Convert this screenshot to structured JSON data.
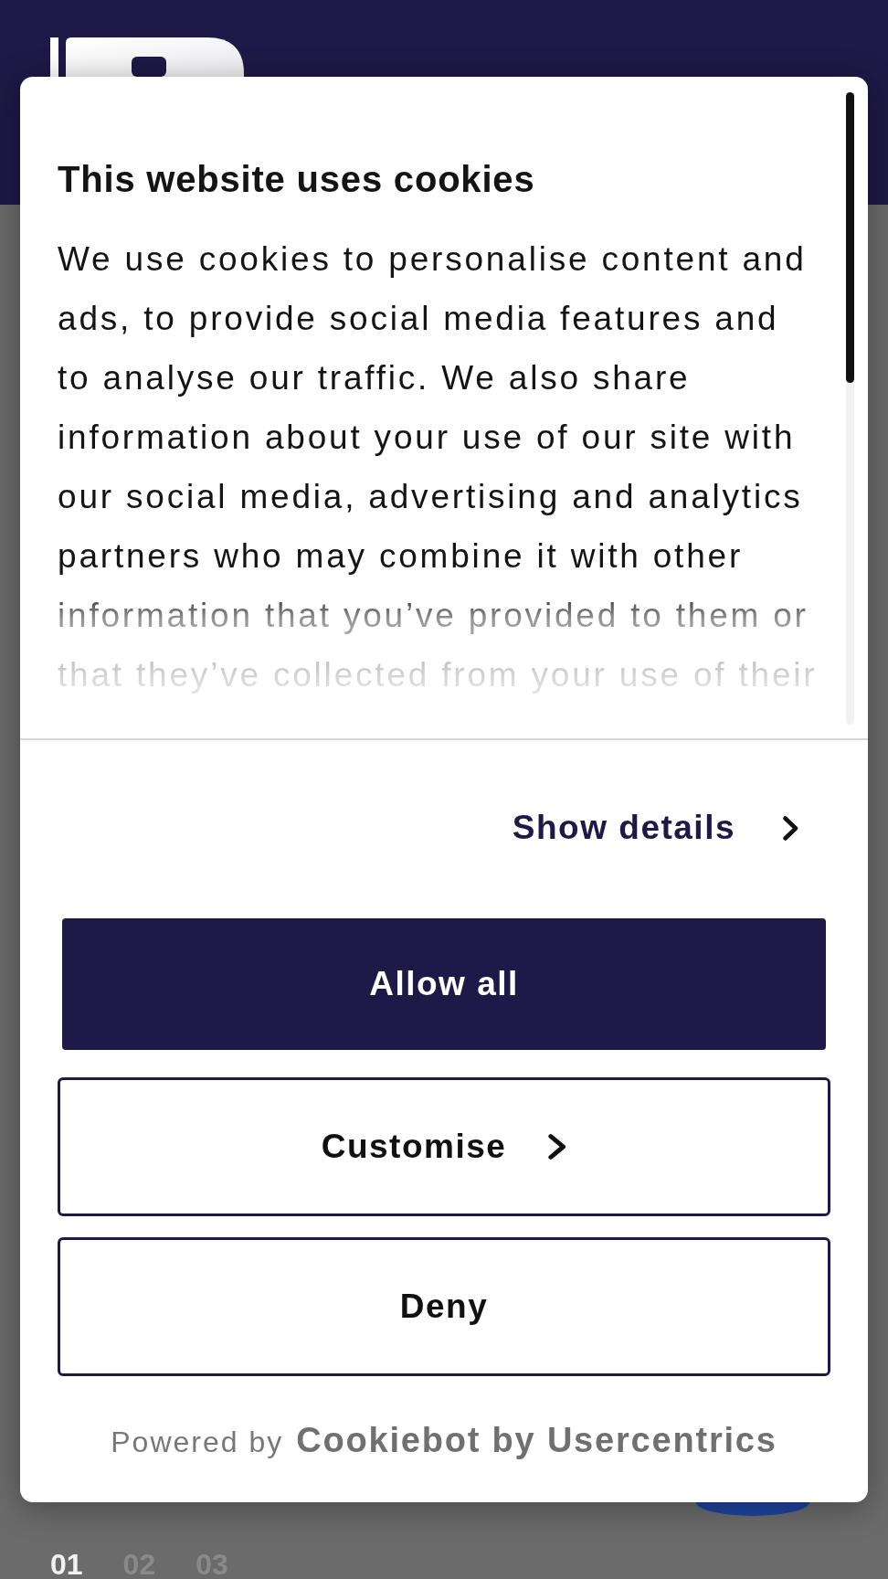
{
  "dialog": {
    "title": "This website uses cookies",
    "body": "We use cookies to personalise content and ads, to provide social media features and to analyse our traffic. We also share information about your use of our site with our social media, advertising and analytics partners who may combine it with other information that you’ve provided to them or that they’ve collected from your use of their",
    "show_details": {
      "label": "Show details"
    },
    "buttons": [
      {
        "label": "Allow all",
        "kind": "primary",
        "arrow": false
      },
      {
        "label": "Customise",
        "kind": "outline",
        "arrow": true
      },
      {
        "label": "Deny",
        "kind": "outline",
        "arrow": false
      }
    ],
    "powered_by": "Powered by",
    "brand": "Cookiebot by Usercentrics"
  },
  "slides": [
    {
      "label": "01",
      "selected": true
    },
    {
      "label": "02",
      "selected": false
    },
    {
      "label": "03",
      "selected": false
    }
  ]
}
